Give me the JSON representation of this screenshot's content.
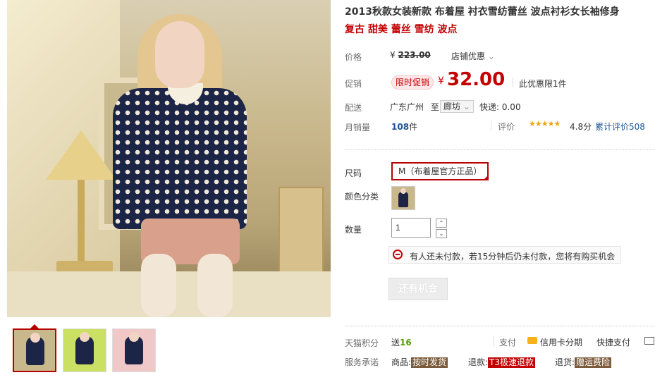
{
  "product": {
    "title": "2013秋款女装新款 布着屋 衬衣雪纺蕾丝 波点衬衫女长袖修身",
    "subtitle": "复古 甜美 蕾丝 雪纺 波点"
  },
  "images": {
    "main_alt": "product main photo",
    "thumbnails": [
      "thumb-1",
      "thumb-2",
      "thumb-3"
    ]
  },
  "price": {
    "label": "价格",
    "currency": "¥",
    "original": "223.00",
    "shop_promo": "店铺优惠",
    "shop_promo_arrow": "⌄"
  },
  "promotion": {
    "label": "促销",
    "tag": "限时促销",
    "currency": "¥",
    "price": "32.00",
    "limit_note": "此优惠限1件"
  },
  "delivery": {
    "label": "配送",
    "from": "广东广州",
    "to_prefix": "至",
    "destination": "廊坊",
    "dest_arrow": "⌄",
    "fee": "快递: 0.00"
  },
  "sales": {
    "label": "月销量",
    "count": "108",
    "unit": "件",
    "rating_label": "评价",
    "stars": "★★★★★",
    "star_rating": 4.8,
    "score": "4.8分",
    "review_link": "累计评价508"
  },
  "options": {
    "size_label": "尺码",
    "size_selected": "M（布着屋官方正品）",
    "color_label": "颜色分类",
    "qty_label": "数量",
    "qty_value": "1",
    "qty_up": "⌃",
    "qty_down": "⌄"
  },
  "alert": {
    "text": "有人还未付款，若15分钟后仍未付款，您将有购买机会"
  },
  "button": {
    "chance": "还有机会"
  },
  "footer": {
    "points_label": "天猫积分",
    "points_prefix": "送",
    "points_value": "16",
    "pay_label": "支付",
    "credit_text": "信用卡分期",
    "express_pay": "快捷支付",
    "service_label": "服务承诺",
    "goods_label": "商品:",
    "goods_tag": "按时发货",
    "refund_label": "退款:",
    "refund_tag": "T3极速退款",
    "return_label": "退货:",
    "return_tag": "赠运费险"
  },
  "colors": {
    "brand_red": "#c40000",
    "link_blue": "#1e5494",
    "star_orange": "#f0a30a"
  }
}
